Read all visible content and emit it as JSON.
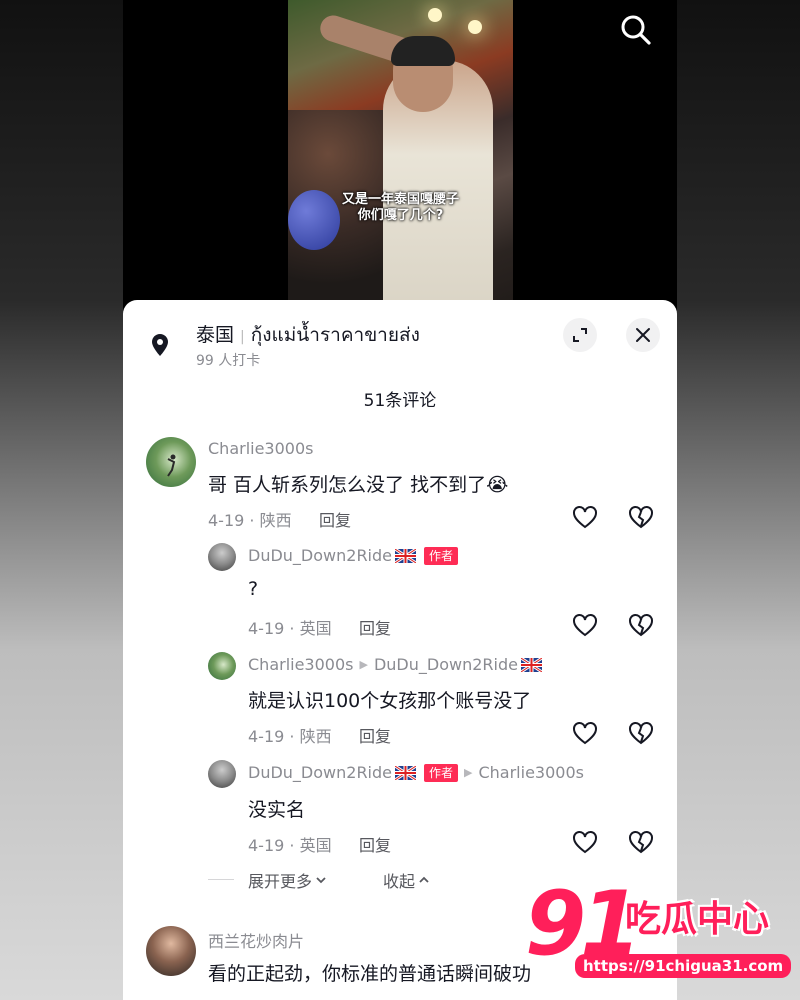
{
  "video": {
    "caption_line1": "又是一年泰国嘎腰子",
    "caption_line2": "你们嘎了几个?"
  },
  "location": {
    "country": "泰国",
    "place": "กุ้งแม่น้ำราคาขายส่ง",
    "checkins": "99 人打卡"
  },
  "comments_count": "51条评论",
  "reply_label": "回复",
  "author_badge": "作者",
  "comments": [
    {
      "user": "Charlie3000s",
      "text": "哥 百人斩系列怎么没了 找不到了",
      "emoji": "😭",
      "date": "4-19",
      "region": "陕西"
    },
    {
      "user": "DuDu_Down2Ride",
      "text": "?",
      "date": "4-19",
      "region": "英国"
    },
    {
      "user": "Charlie3000s",
      "reply_to": "DuDu_Down2Ride",
      "text": "就是认识100个女孩那个账号没了",
      "date": "4-19",
      "region": "陕西"
    },
    {
      "user": "DuDu_Down2Ride",
      "reply_to": "Charlie3000s",
      "text": "没实名",
      "date": "4-19",
      "region": "英国"
    },
    {
      "user": "西兰花炒肉片",
      "text": "看的正起劲，你标准的普通话瞬间破功"
    }
  ],
  "expand_more": "展开更多",
  "collapse": "收起",
  "watermark": {
    "brand_number": "91",
    "brand_text": "吃瓜中心",
    "url": "https://91chigua31.com"
  },
  "colors": {
    "accent": "#fe2c55",
    "text_primary": "#161823",
    "text_secondary": "#8a8b91"
  }
}
